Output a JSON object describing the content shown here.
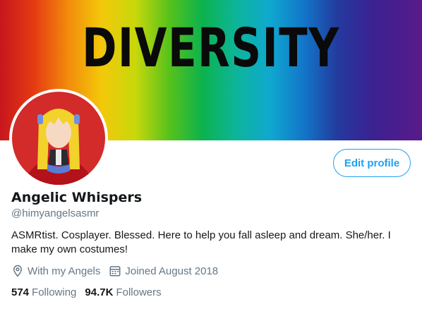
{
  "banner": {
    "text": "DIVERSITY"
  },
  "profile": {
    "name": "Angelic Whispers",
    "handle": "@himyangelsasmr",
    "bio": "ASMRtist. Cosplayer. Blessed. Here to help you fall asleep and dream. She/her. I make my own costumes!",
    "location": "With my Angels",
    "joined": "Joined August 2018"
  },
  "actions": {
    "edit_profile": "Edit profile"
  },
  "stats": {
    "following_count": "574",
    "following_label": "Following",
    "followers_count": "94.7K",
    "followers_label": "Followers"
  },
  "colors": {
    "accent": "#1da1f2",
    "secondary_text": "#657786",
    "avatar_bg": "#d32a2a"
  }
}
